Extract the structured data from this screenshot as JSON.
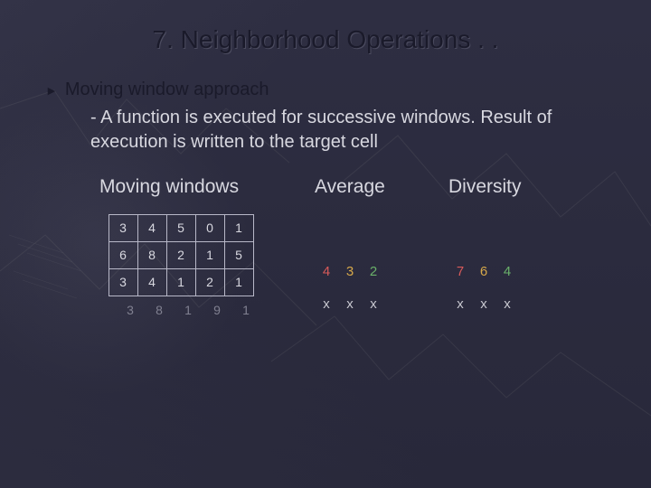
{
  "title": "7. Neighborhood Operations . .",
  "bullet": "Moving window approach",
  "sub": "- A function is executed for successive windows. Result of execution is written to the target cell",
  "headings": {
    "moving": "Moving windows",
    "average": "Average",
    "diversity": "Diversity"
  },
  "grid": [
    [
      "3",
      "4",
      "5",
      "0",
      "1"
    ],
    [
      "6",
      "8",
      "2",
      "1",
      "5"
    ],
    [
      "3",
      "4",
      "1",
      "2",
      "1"
    ]
  ],
  "ghost": [
    "3",
    "8",
    "1",
    "9",
    "1"
  ],
  "average": [
    [
      "4",
      "3",
      "2"
    ],
    [
      "x",
      "x",
      "x"
    ]
  ],
  "diversity": [
    [
      "7",
      "6",
      "4"
    ],
    [
      "x",
      "x",
      "x"
    ]
  ],
  "colorSeq": [
    "c-red",
    "c-yellow",
    "c-green"
  ]
}
